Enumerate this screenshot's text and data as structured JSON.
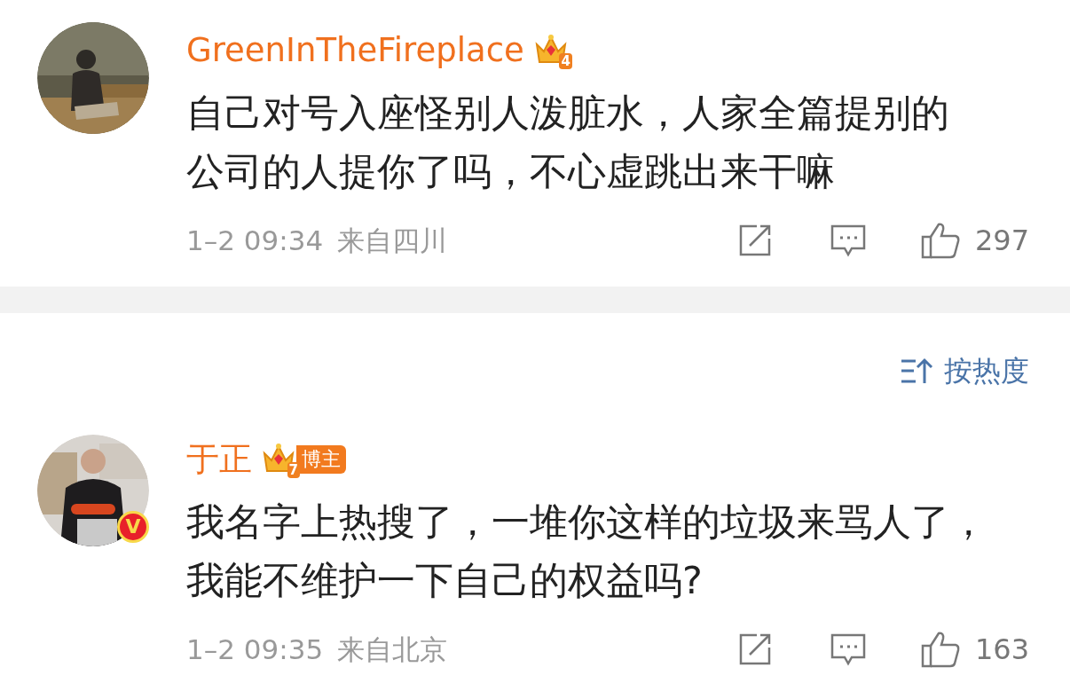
{
  "comments": [
    {
      "username": "GreenInTheFireplace",
      "level_badge": "4",
      "text_lines": [
        "自己对号入座怪别人泼脏水，人家全篇提别的",
        "公司的人提你了吗，不心虚跳出来干嘛"
      ],
      "time": "1–2 09:34",
      "location": "来自四川",
      "likes": "297"
    }
  ],
  "sort": {
    "label": "按热度"
  },
  "replies": [
    {
      "username": "于正",
      "level_badge": "7",
      "tag": "博主",
      "verified_badge": "V",
      "text_lines": [
        "我名字上热搜了，一堆你这样的垃圾来骂人了，",
        "我能不维护一下自己的权益吗?"
      ],
      "time": "1–2 09:35",
      "location": "来自北京",
      "likes": "163"
    }
  ]
}
